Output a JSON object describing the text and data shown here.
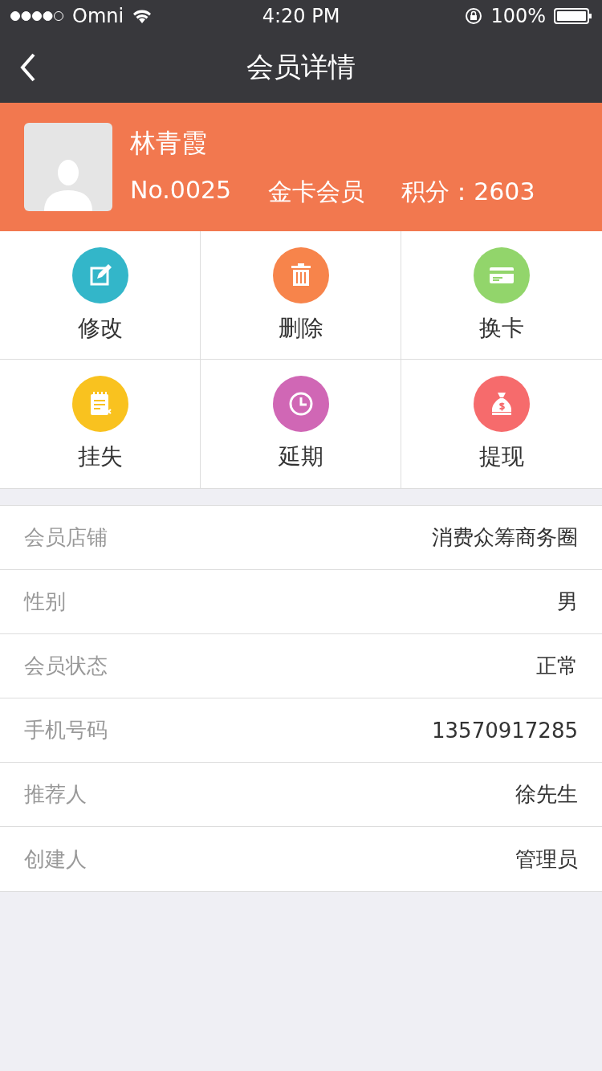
{
  "status_bar": {
    "carrier": "Omni",
    "time": "4:20 PM",
    "battery": "100%"
  },
  "nav": {
    "title": "会员详情"
  },
  "member": {
    "name": "林青霞",
    "number": "No.0025",
    "level": "金卡会员",
    "points": "积分：2603"
  },
  "actions": [
    {
      "label": "修改",
      "kind": "edit",
      "color": "#33b6c9"
    },
    {
      "label": "删除",
      "kind": "trash",
      "color": "#f7844b"
    },
    {
      "label": "换卡",
      "kind": "card",
      "color": "#92d56b"
    },
    {
      "label": "挂失",
      "kind": "notepad",
      "color": "#f9c21f"
    },
    {
      "label": "延期",
      "kind": "clock",
      "color": "#d067b5"
    },
    {
      "label": "提现",
      "kind": "moneybag",
      "color": "#f66b6c"
    }
  ],
  "details": [
    {
      "label": "会员店铺",
      "value": "消费众筹商务圈"
    },
    {
      "label": "性别",
      "value": "男"
    },
    {
      "label": "会员状态",
      "value": "正常"
    },
    {
      "label": "手机号码",
      "value": "13570917285"
    },
    {
      "label": "推荐人",
      "value": "徐先生"
    },
    {
      "label": "创建人",
      "value": "管理员"
    }
  ]
}
